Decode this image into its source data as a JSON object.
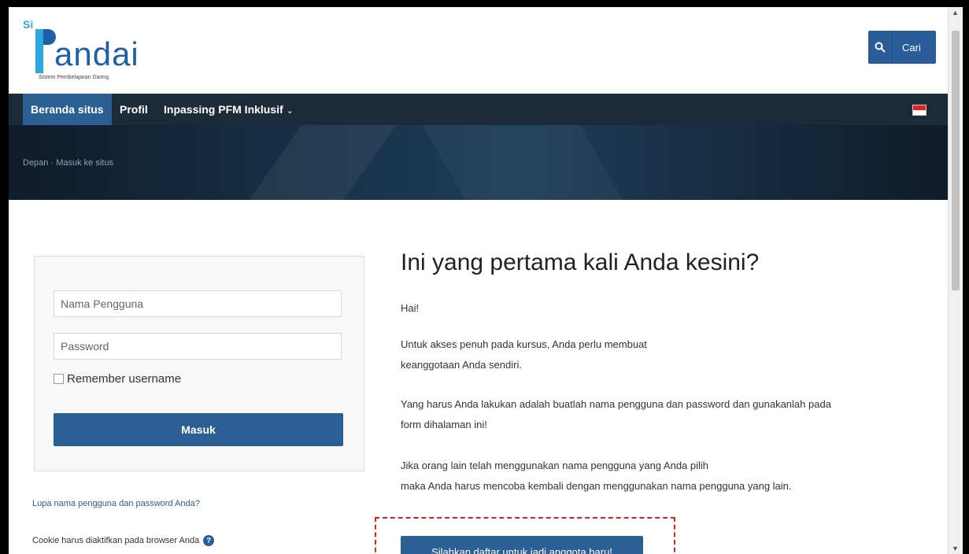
{
  "header": {
    "logo": {
      "si": "Si",
      "word": "andai",
      "tagline": "Sistem Pembelajaran Daring"
    },
    "search": {
      "label": "Cari",
      "icon": "search-icon"
    }
  },
  "nav": {
    "items": [
      {
        "label": "Beranda situs",
        "active": true
      },
      {
        "label": "Profil"
      },
      {
        "label": "Inpassing PFM Inklusif",
        "has_dropdown": true
      }
    ],
    "language_icon": "indonesia-flag-icon"
  },
  "breadcrumb": "Depan · Masuk ke situs",
  "login": {
    "username_placeholder": "Nama Pengguna",
    "password_placeholder": "Password",
    "remember_label": "Remember username",
    "submit_label": "Masuk"
  },
  "forgot_link": "Lupa nama pengguna dan password Anda?",
  "cookie_note": "Cookie harus diaktifkan pada browser Anda",
  "signup": {
    "title": "Ini yang pertama kali Anda kesini?",
    "p1": "Hai!",
    "p2a": "Untuk akses penuh pada kursus, Anda perlu membuat",
    "p2b": "keanggotaan Anda sendiri.",
    "p3a": "Yang harus Anda lakukan adalah buatlah nama pengguna dan password dan gunakanlah pada",
    "p3b": "form dihalaman ini!",
    "p4a": "Jika orang lain telah menggunakan nama pengguna yang Anda pilih",
    "p4b": "maka Anda harus mencoba kembali dengan menggunakan nama pengguna yang lain.",
    "button_label": "Silahkan daftar untuk jadi anggota baru!"
  },
  "colors": {
    "primary": "#2c5f93",
    "navbar": "#1c2b3a",
    "highlight": "#e0201b"
  }
}
